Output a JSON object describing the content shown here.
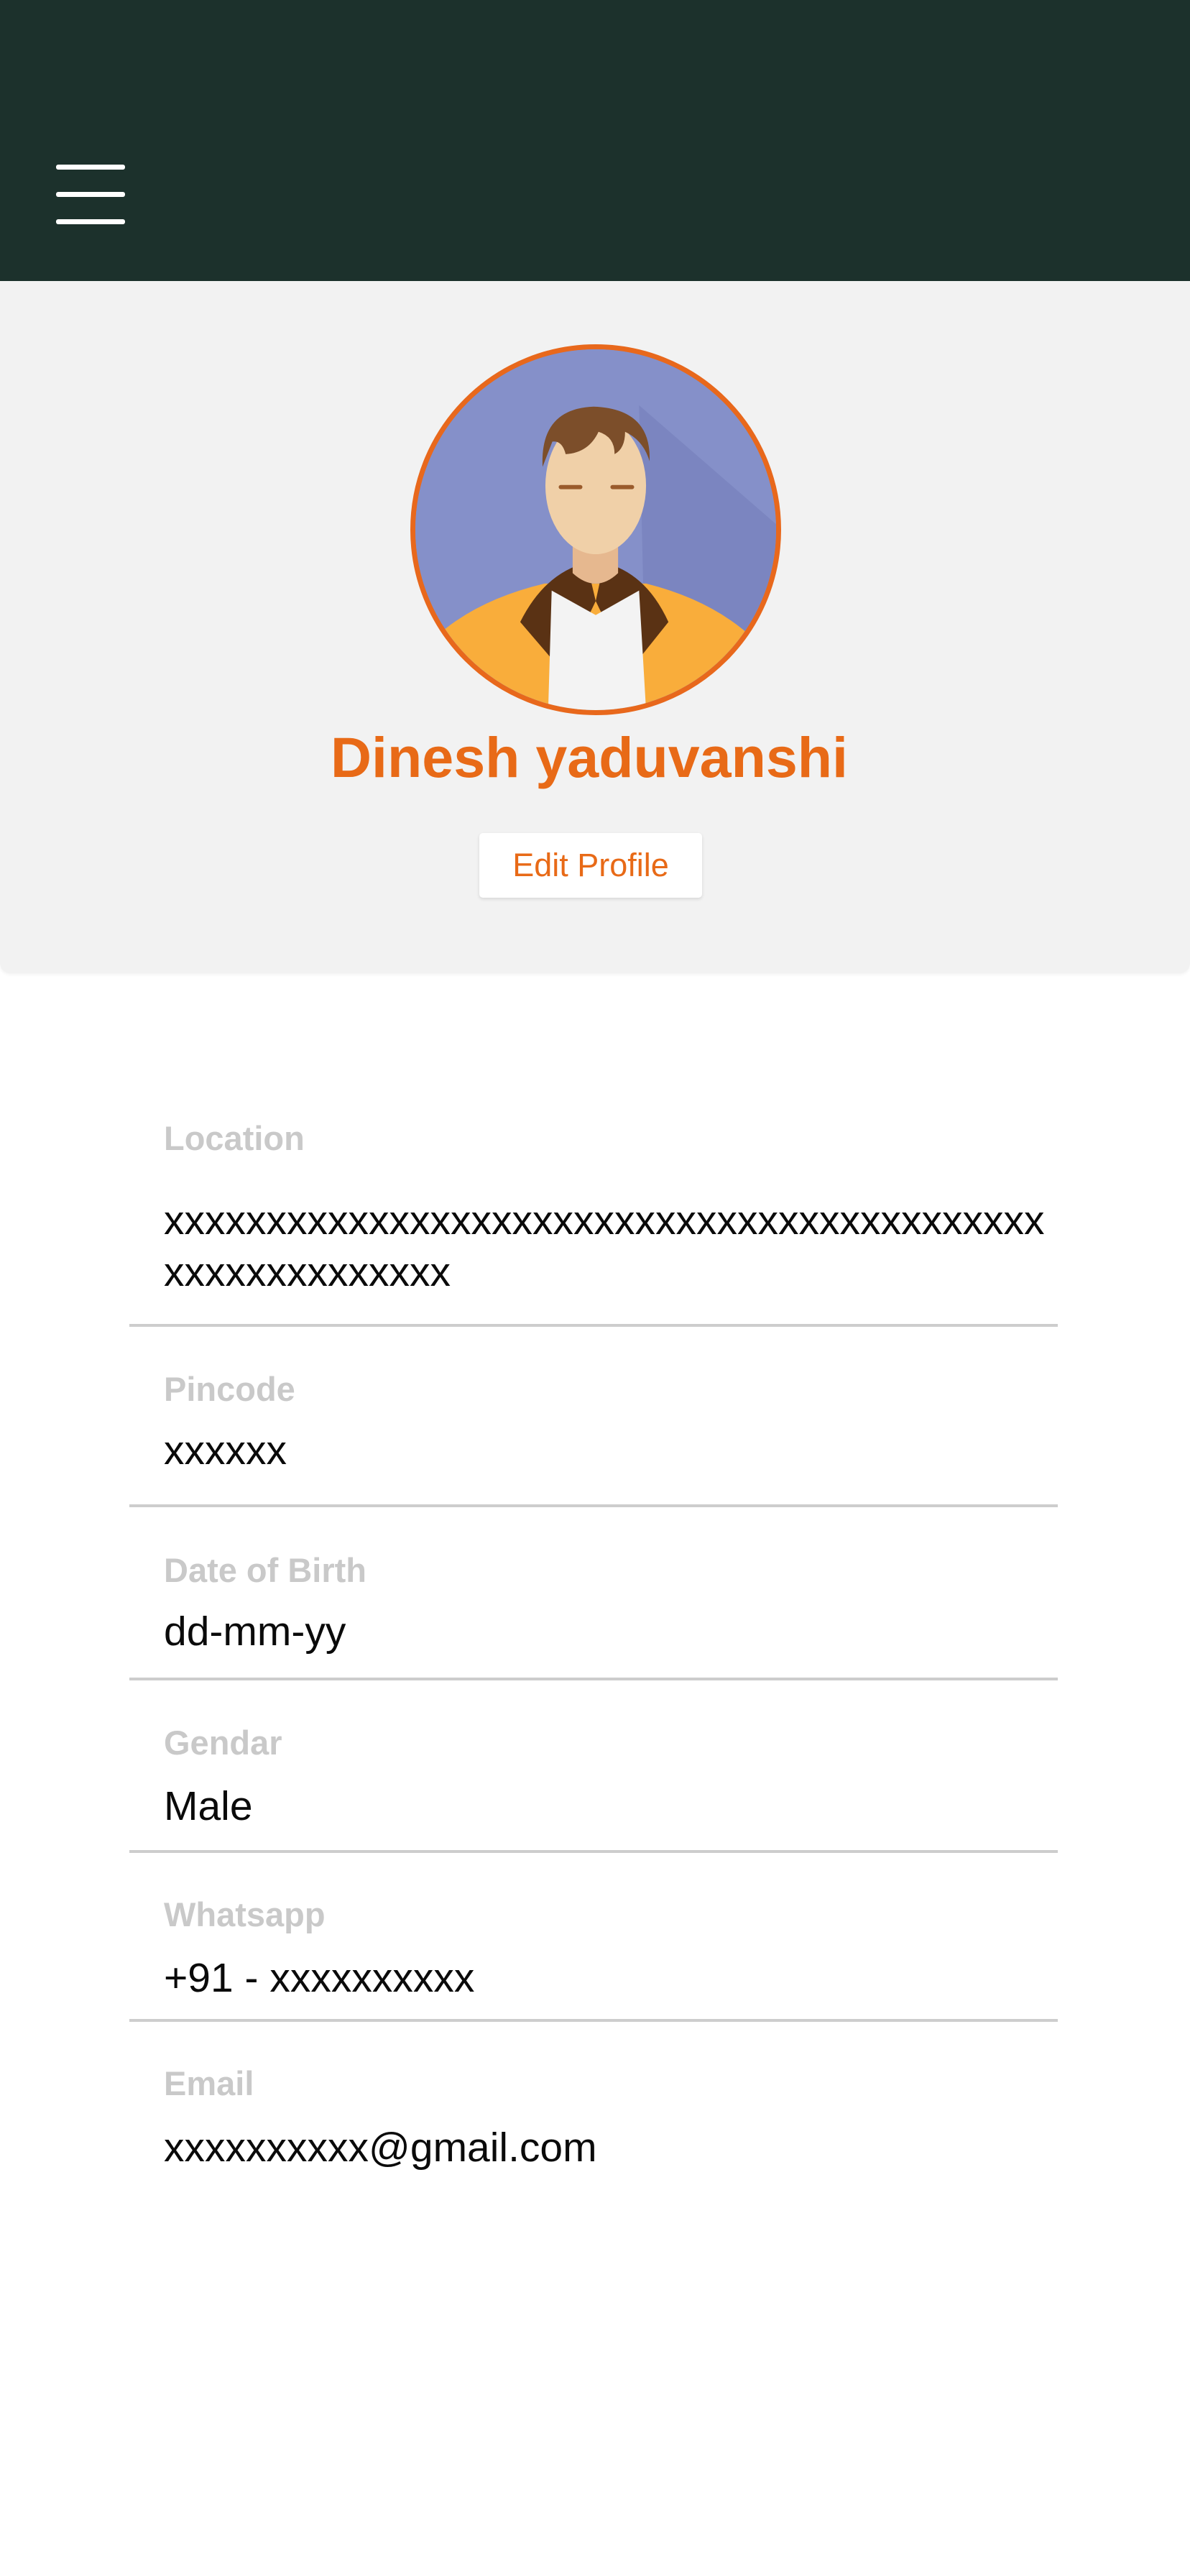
{
  "profile": {
    "name": "Dinesh yaduvanshi",
    "edit_button_label": "Edit Profile"
  },
  "fields": {
    "location": {
      "label": "Location",
      "value": "xxxxxxxxxxxxxxxxxxxxxxxxxxxxxxxxxxxxxxxxxxxxxxxxxxxxxxxxx"
    },
    "pincode": {
      "label": "Pincode",
      "value": "xxxxxx"
    },
    "dob": {
      "label": "Date of Birth",
      "value": "dd-mm-yy"
    },
    "gender": {
      "label": "Gendar",
      "value": "Male"
    },
    "whatsapp": {
      "label": "Whatsapp",
      "value": "+91 - xxxxxxxxxx"
    },
    "email": {
      "label": "Email",
      "value": "xxxxxxxxxx@gmail.com"
    }
  },
  "colors": {
    "app_bar": "#1c312c",
    "accent": "#e86a17",
    "header_bg": "#f2f2f2",
    "label": "#c9c9c9",
    "divider": "#cdcdcd"
  },
  "icons": {
    "menu": "hamburger-menu-icon",
    "avatar": "user-avatar-illustration"
  }
}
